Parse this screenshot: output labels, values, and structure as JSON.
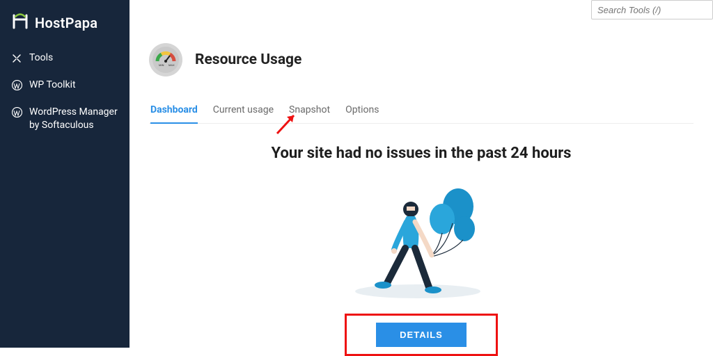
{
  "brand": {
    "name": "HostPapa"
  },
  "sidebar": {
    "items": [
      {
        "label": "Tools"
      },
      {
        "label": "WP Toolkit"
      },
      {
        "label": "WordPress Manager by Softaculous"
      }
    ]
  },
  "search": {
    "placeholder": "Search Tools (/)"
  },
  "page": {
    "title": "Resource Usage"
  },
  "tabs": [
    {
      "label": "Dashboard",
      "active": true
    },
    {
      "label": "Current usage"
    },
    {
      "label": "Snapshot"
    },
    {
      "label": "Options"
    }
  ],
  "status": {
    "headline": "Your site had no issues in the past 24 hours"
  },
  "actions": {
    "details": "DETAILS"
  },
  "colors": {
    "accent": "#2a8fe6",
    "sidebar_bg": "#17263b",
    "highlight_border": "#e11"
  }
}
